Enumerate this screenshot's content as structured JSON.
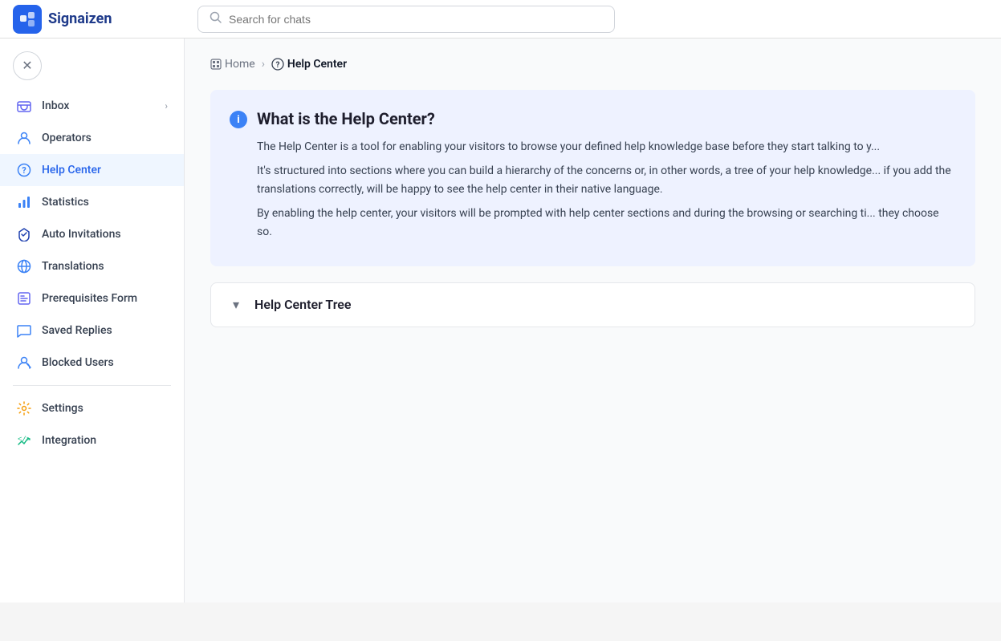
{
  "header": {
    "logo_text": "Signaizen",
    "search_placeholder": "Search for chats"
  },
  "sidebar": {
    "close_label": "×",
    "items": [
      {
        "id": "inbox",
        "label": "Inbox",
        "icon": "inbox-icon",
        "has_arrow": true,
        "active": false
      },
      {
        "id": "operators",
        "label": "Operators",
        "icon": "operators-icon",
        "has_arrow": false,
        "active": false
      },
      {
        "id": "help-center",
        "label": "Help Center",
        "icon": "helpcenter-icon",
        "has_arrow": false,
        "active": true
      },
      {
        "id": "statistics",
        "label": "Statistics",
        "icon": "statistics-icon",
        "has_arrow": false,
        "active": false
      },
      {
        "id": "auto-invitations",
        "label": "Auto Invitations",
        "icon": "autoinvitations-icon",
        "has_arrow": false,
        "active": false
      },
      {
        "id": "translations",
        "label": "Translations",
        "icon": "translations-icon",
        "has_arrow": false,
        "active": false
      },
      {
        "id": "prerequisites-form",
        "label": "Prerequisites Form",
        "icon": "prerequisites-icon",
        "has_arrow": false,
        "active": false
      },
      {
        "id": "saved-replies",
        "label": "Saved Replies",
        "icon": "savedreplies-icon",
        "has_arrow": false,
        "active": false
      },
      {
        "id": "blocked-users",
        "label": "Blocked Users",
        "icon": "blockedusers-icon",
        "has_arrow": false,
        "active": false
      }
    ],
    "bottom_items": [
      {
        "id": "settings",
        "label": "Settings",
        "icon": "settings-icon"
      },
      {
        "id": "integration",
        "label": "Integration",
        "icon": "integration-icon"
      }
    ]
  },
  "breadcrumb": {
    "home_label": "Home",
    "separator": "›",
    "current_label": "Help Center"
  },
  "info_box": {
    "title": "What is the Help Center?",
    "paragraph1": "The Help Center is a tool for enabling your visitors to browse your defined help knowledge base before they start talking to y...",
    "paragraph2": "It's structured into sections where you can build a hierarchy of the concerns or, in other words, a tree of your help knowledge... if you add the translations correctly, will be happy to see the help center in their native language.",
    "paragraph3": "By enabling the help center, your visitors will be prompted with help center sections and during the browsing or searching ti... they choose so."
  },
  "tree_section": {
    "title": "Help Center Tree",
    "chevron": "▾"
  }
}
